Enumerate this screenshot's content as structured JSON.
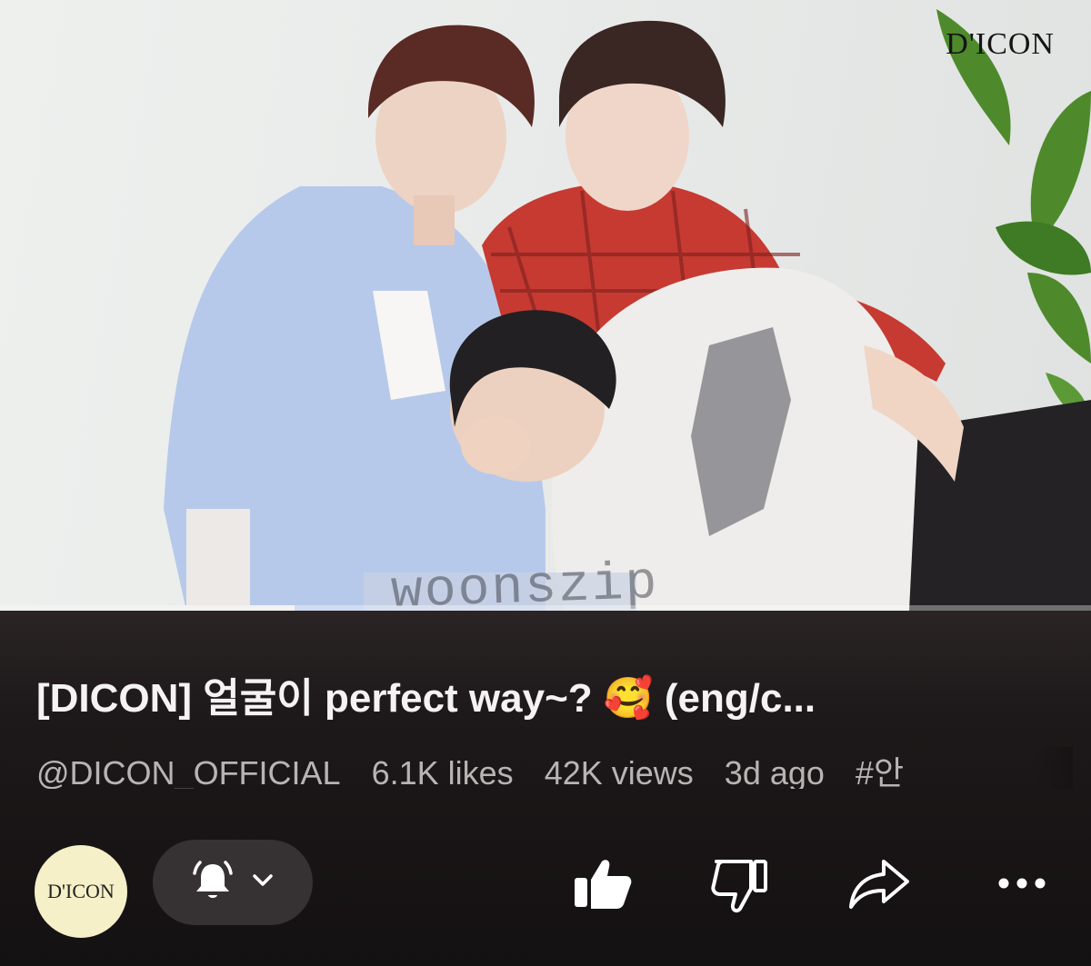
{
  "video": {
    "brand_mark": "D'ICON",
    "watermark": "woonszip",
    "progress": 0.27
  },
  "info": {
    "title": "[DICON] 얼굴이 perfect way~? 🥰 (eng/c...",
    "channel": "@DICON_OFFICIAL",
    "likes": "6.1K likes",
    "views": "42K views",
    "age": "3d ago",
    "hashtag": "#안"
  },
  "actions": {
    "avatar_text": "D'ICON",
    "icons": [
      "bell-icon",
      "chevron-down-icon",
      "thumbs-up-icon",
      "thumbs-down-icon",
      "share-icon",
      "more-icon"
    ]
  }
}
